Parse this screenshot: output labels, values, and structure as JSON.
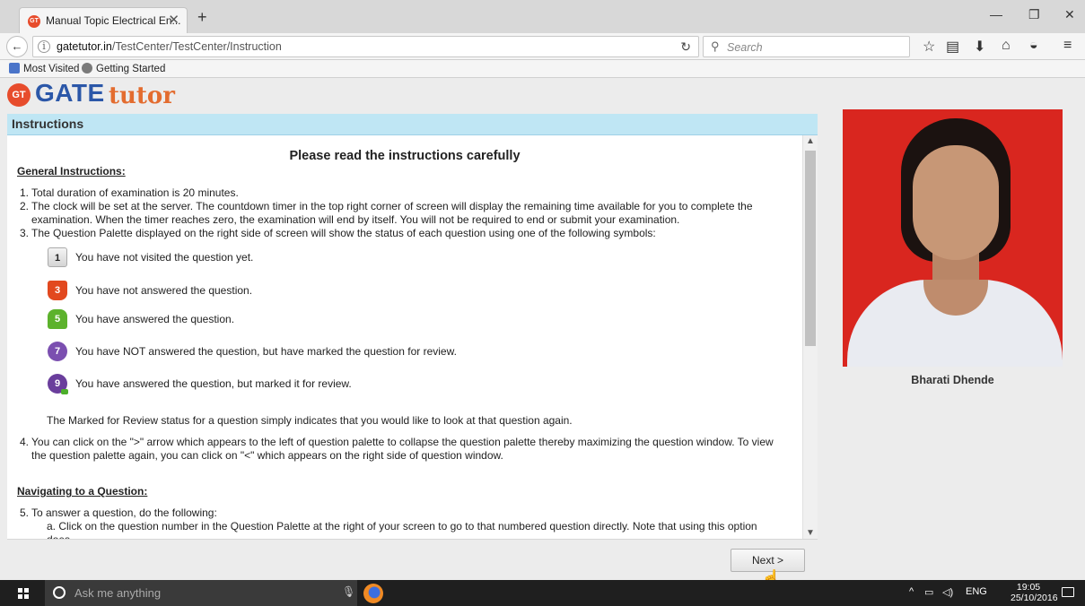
{
  "browser": {
    "tab_title": "Manual Topic Electrical En...",
    "url_host": "gatetutor.in",
    "url_path": "/TestCenter/TestCenter/Instruction",
    "search_placeholder": "Search",
    "bookmarks": [
      "Most Visited",
      "Getting Started"
    ]
  },
  "logo": {
    "gt": "GT",
    "gate": "GATE",
    "tutor": "tutor"
  },
  "instructions": {
    "header": "Instructions",
    "heading": "Please read the instructions carefully",
    "general_title": "General Instructions:",
    "p1": "Total duration of examination is 20 minutes.",
    "p2": "The clock will be set at the server. The countdown timer in the top right corner of screen will display the remaining time available for you to complete the examination. When the timer reaches zero, the examination will end by itself. You will not be required to end or submit your examination.",
    "p3": "The Question Palette displayed on the right side of screen will show the status of each question using one of the following symbols:",
    "symbols": [
      {
        "num": "1",
        "text": "You have not visited the question yet."
      },
      {
        "num": "3",
        "text": "You have not answered the question."
      },
      {
        "num": "5",
        "text": "You have answered the question."
      },
      {
        "num": "7",
        "text": "You have NOT answered the question, but have marked the question for review."
      },
      {
        "num": "9",
        "text": "You have answered the question, but marked it for review."
      }
    ],
    "marked_note": "The Marked for Review status for a question simply indicates that you would like to look at that question again.",
    "p4": "You can click on the \">\" arrow which appears to the left of question palette to collapse the question palette thereby maximizing the question window. To view the question palette again, you can click on \"<\" which appears on the right side of question window.",
    "nav_title": "Navigating to a Question:",
    "p5": "To answer a question, do the following:",
    "p5a": "a. Click on the question number in the Question Palette at the right of your screen to go to that numbered question directly. Note that using this option does"
  },
  "next_button": "Next >",
  "candidate": {
    "name": "Bharati Dhende"
  },
  "taskbar": {
    "search_placeholder": "Ask me anything",
    "lang": "ENG",
    "time": "19:05",
    "date": "25/10/2016"
  }
}
